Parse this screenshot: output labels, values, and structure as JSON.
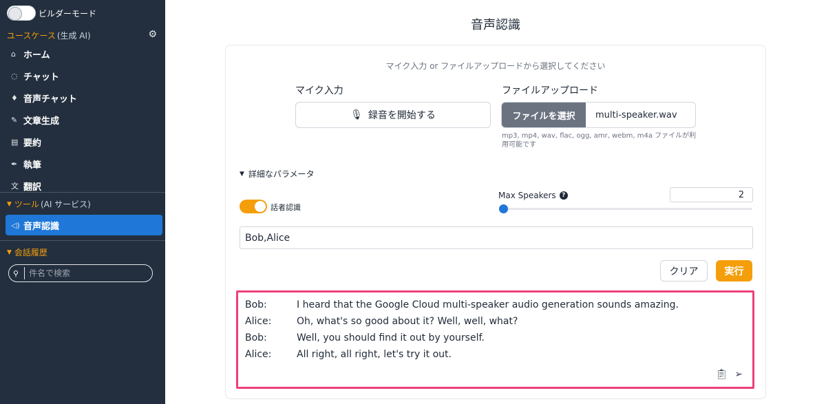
{
  "sidebar": {
    "builder_mode_label": "ビルダーモード",
    "usecase_section": {
      "label": "ユースケース",
      "sub": "(生成 AI)"
    },
    "items": [
      {
        "label": "ホーム",
        "icon": "home-icon",
        "glyph": "⌂"
      },
      {
        "label": "チャット",
        "icon": "chat-icon",
        "glyph": "◌"
      },
      {
        "label": "音声チャット",
        "icon": "mic-icon",
        "glyph": "♦"
      },
      {
        "label": "文章生成",
        "icon": "pencil-icon",
        "glyph": "✎"
      },
      {
        "label": "要約",
        "icon": "summary-icon",
        "glyph": "▤"
      },
      {
        "label": "執筆",
        "icon": "pen-icon",
        "glyph": "✒"
      },
      {
        "label": "翻訳",
        "icon": "translate-icon",
        "glyph": "文"
      }
    ],
    "tools_section": {
      "label": "ツール",
      "sub": "(AI サービス)"
    },
    "tools_items": [
      {
        "label": "音声認識",
        "icon": "speaker-icon",
        "glyph": "◁)",
        "active": true
      }
    ],
    "history_section": {
      "label": "会話履歴"
    },
    "search": {
      "placeholder": "件名で検索"
    }
  },
  "main": {
    "title": "音声認識",
    "hint": "マイク入力 or ファイルアップロードから選択してください",
    "mic": {
      "label": "マイク入力",
      "button": "録音を開始する"
    },
    "upload": {
      "label": "ファイルアップロード",
      "button": "ファイルを選択",
      "file_name": "multi-speaker.wav",
      "note": "mp3, mp4, wav, flac, ogg, amr, webm, m4a ファイルが利用可能です"
    },
    "details_label": "詳細なパラメータ",
    "diarization": {
      "label": "話者認識",
      "enabled": true
    },
    "max_speakers": {
      "label": "Max Speakers",
      "value": "2"
    },
    "speaker_names": "Bob,Alice",
    "clear_button": "クリア",
    "run_button": "実行",
    "transcript": [
      {
        "speaker": "Bob:",
        "text": "I heard that the Google Cloud multi-speaker audio generation sounds amazing."
      },
      {
        "speaker": "Alice:",
        "text": "Oh, what's so good about it? Well, well, what?"
      },
      {
        "speaker": "Bob:",
        "text": "Well, you should find it out by yourself."
      },
      {
        "speaker": "Alice:",
        "text": "All right, all right, let's try it out."
      }
    ]
  },
  "colors": {
    "accent": "#f59e0b",
    "active": "#1f77d8",
    "sidebar_bg": "#232f3e",
    "highlight": "#ec407a"
  }
}
